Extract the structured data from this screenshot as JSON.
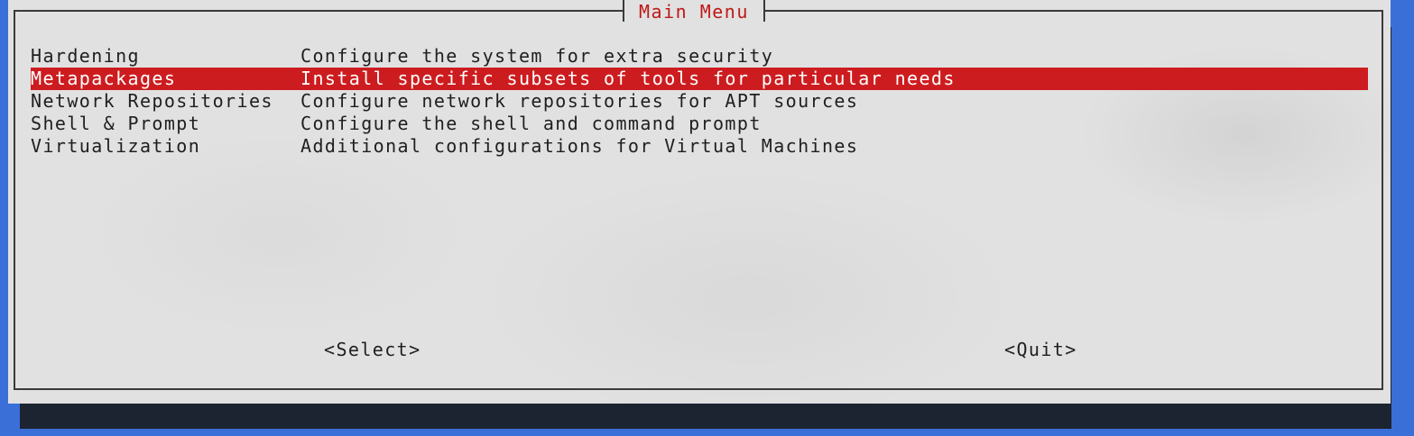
{
  "dialog": {
    "title": "Main Menu"
  },
  "menu": {
    "items": [
      {
        "name": "Hardening",
        "description": "Configure the system for extra security"
      },
      {
        "name": "Metapackages",
        "description": "Install specific subsets of tools for particular needs"
      },
      {
        "name": "Network Repositories",
        "description": "Configure network repositories for APT sources"
      },
      {
        "name": "Shell & Prompt",
        "description": "Configure the shell and command prompt"
      },
      {
        "name": "Virtualization",
        "description": "Additional configurations for Virtual Machines"
      }
    ],
    "selected_index": 1
  },
  "buttons": {
    "select_label": "<Select>",
    "quit_label": "<Quit>"
  },
  "colors": {
    "screen_background": "#3a6fd8",
    "dialog_background": "#e1e1e1",
    "highlight": "#cd1c1f",
    "title_text": "#c01818",
    "shadow": "#1c2331"
  }
}
